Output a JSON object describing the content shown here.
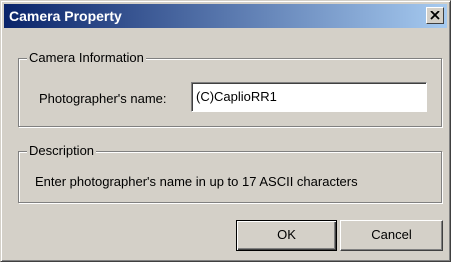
{
  "window": {
    "title": "Camera Property",
    "close_icon": "close-icon"
  },
  "camera_info": {
    "legend": "Camera Information",
    "photographer_label": "Photographer's name:",
    "photographer_value": "(C)CaplioRR1"
  },
  "description": {
    "legend": "Description",
    "text": "Enter photographer's name in up to 17 ASCII characters"
  },
  "buttons": {
    "ok": "OK",
    "cancel": "Cancel"
  },
  "colors": {
    "title_start": "#0a246a",
    "title_end": "#a6caf0",
    "face": "#d4d0c8"
  }
}
